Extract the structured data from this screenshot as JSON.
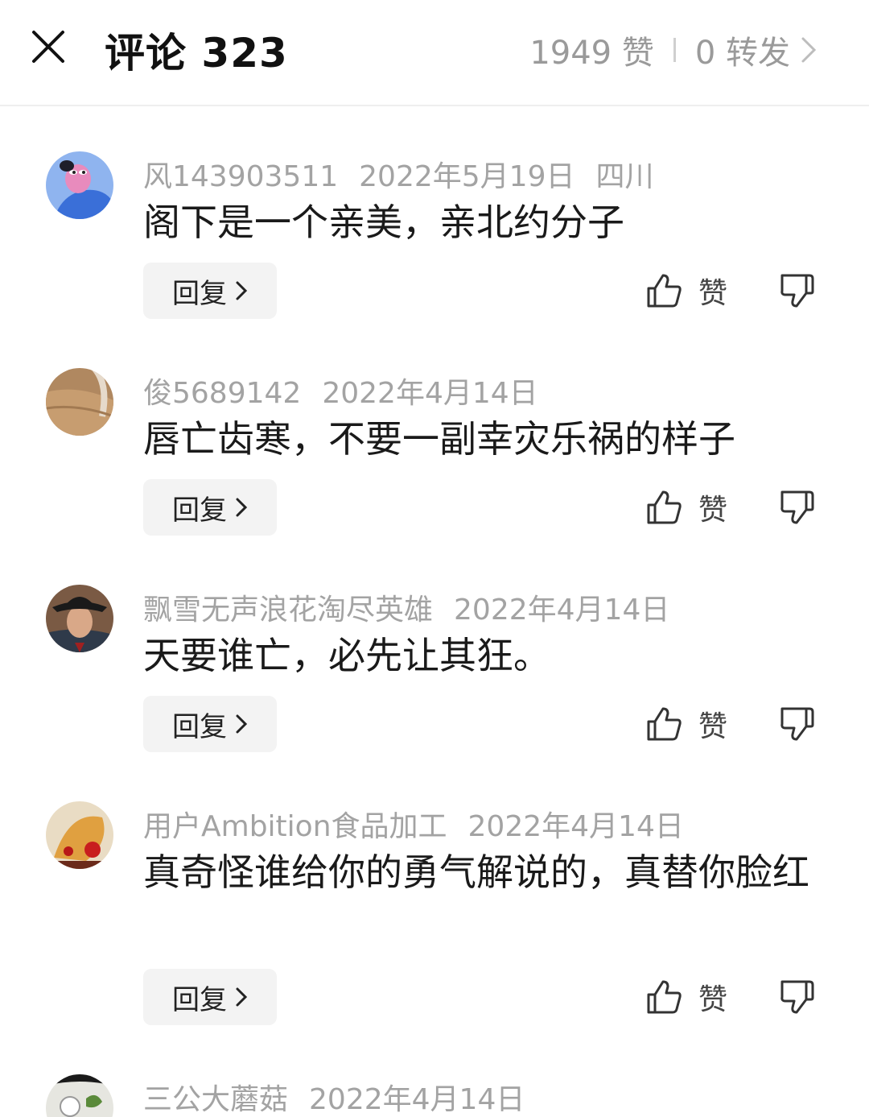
{
  "header": {
    "title": "评论 323",
    "likes": "1949 赞",
    "forwards": "0 转发"
  },
  "comments": [
    {
      "username": "风143903511",
      "date": "2022年5月19日",
      "location": "四川",
      "text": "阁下是一个亲美，亲北约分子",
      "reply_label": "回复",
      "like_label": "赞"
    },
    {
      "username": "俊5689142",
      "date": "2022年4月14日",
      "location": "",
      "text": "唇亡齿寒，不要一副幸灾乐祸的样子",
      "reply_label": "回复",
      "like_label": "赞"
    },
    {
      "username": "飘雪无声浪花淘尽英雄",
      "date": "2022年4月14日",
      "location": "",
      "text": "天要谁亡，必先让其狂。",
      "reply_label": "回复",
      "like_label": "赞"
    },
    {
      "username": "用户Ambition食品加工",
      "date": "2022年4月14日",
      "location": "",
      "text": "真奇怪谁给你的勇气解说的，真替你脸红",
      "reply_label": "回复",
      "like_label": "赞"
    },
    {
      "username": "三公大蘑菇",
      "date": "2022年4月14日",
      "location": "",
      "text": "",
      "reply_label": "",
      "like_label": ""
    }
  ],
  "icons": {
    "close": "close-icon",
    "chevron": "chevron-right-icon",
    "like": "thumbs-up-icon",
    "dislike": "thumbs-down-icon"
  }
}
